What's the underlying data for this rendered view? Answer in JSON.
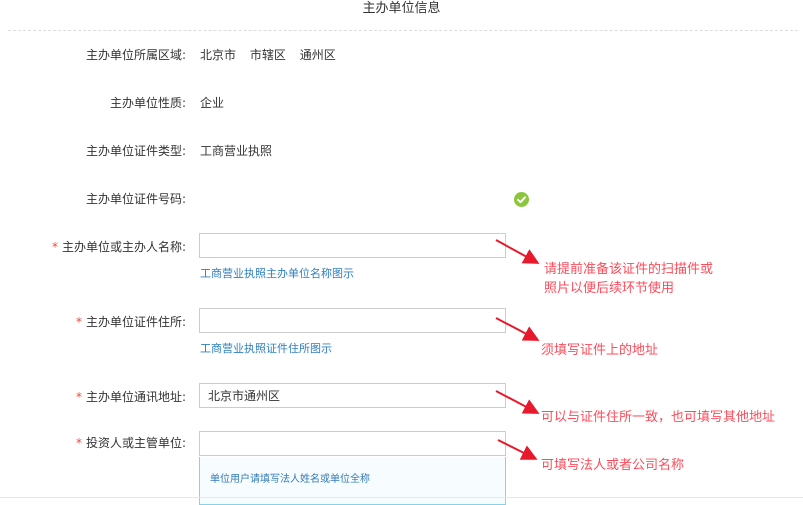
{
  "section": {
    "title": "主办单位信息"
  },
  "fields": {
    "region": {
      "label": "主办单位所属区域:",
      "values": [
        "北京市",
        "市辖区",
        "通州区"
      ]
    },
    "nature": {
      "label": "主办单位性质:",
      "value": "企业"
    },
    "cert_type": {
      "label": "主办单位证件类型:",
      "value": "工商营业执照"
    },
    "cert_number": {
      "label": "主办单位证件号码:",
      "status_icon": "check-circle-icon"
    },
    "host_name": {
      "required_mark": "*",
      "label": "主办单位或主办人名称:",
      "value": "",
      "help_link": "工商营业执照主办单位名称图示"
    },
    "cert_address": {
      "required_mark": "*",
      "label": "主办单位证件住所:",
      "value": "",
      "help_link": "工商营业执照证件住所图示"
    },
    "mail_address": {
      "required_mark": "*",
      "label": "主办单位通讯地址:",
      "value": "北京市通州区"
    },
    "investor": {
      "required_mark": "*",
      "label": "投资人或主管单位:",
      "value": "",
      "tip": "单位用户请填写法人姓名或单位全称"
    }
  },
  "annotations": {
    "host_name": [
      "请提前准备该证件的扫描件或",
      "照片以便后续环节使用"
    ],
    "cert_address": "须填写证件上的地址",
    "mail_address": "可以与证件住所一致，也可填写其他地址",
    "investor": "可填写法人或者公司名称"
  },
  "colors": {
    "required": "#e74c3c",
    "link": "#2f7fc1",
    "success": "#8cc63e",
    "annotation": "#ff4b5a",
    "input_border": "#cccccc",
    "tip_border": "#88d1e6"
  }
}
